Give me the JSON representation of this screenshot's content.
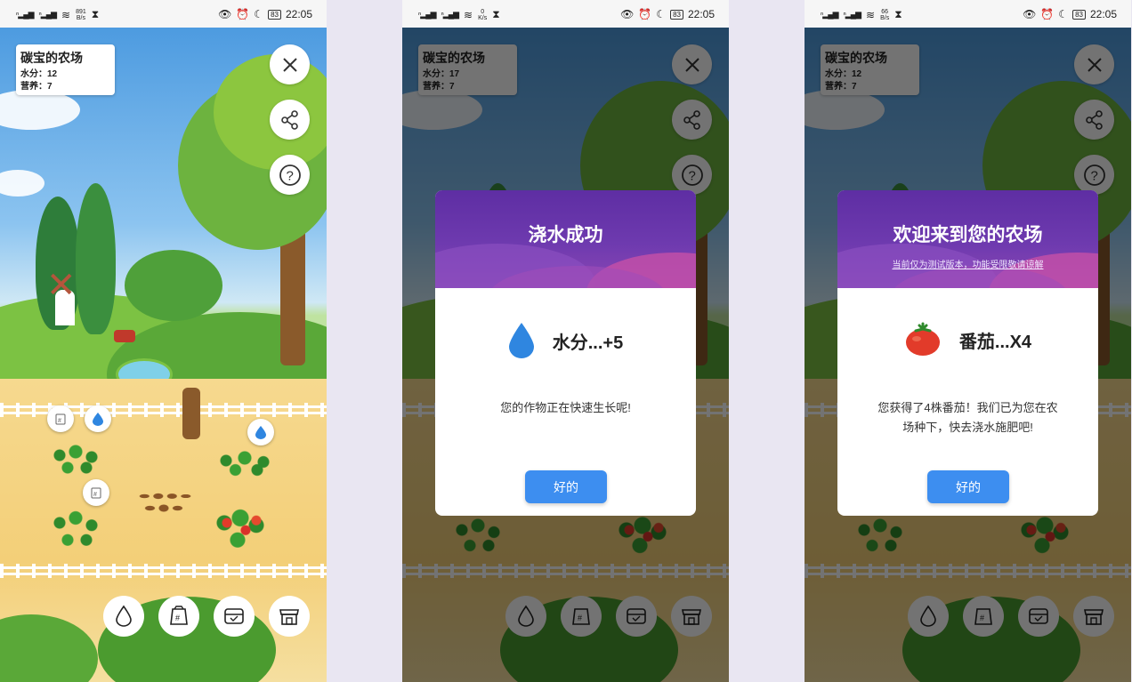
{
  "status": {
    "time": "22:05",
    "speeds": [
      "891\nB/s",
      "0\nK/s",
      "66\nB/s"
    ],
    "battery": "83"
  },
  "farm": {
    "title": "碳宝的农场",
    "water_label": "水分：",
    "nutrition_label": "营养：",
    "screens": [
      {
        "water": "12",
        "nutrition": "7"
      },
      {
        "water": "17",
        "nutrition": "7"
      },
      {
        "water": "12",
        "nutrition": "7"
      }
    ]
  },
  "side_buttons": [
    "close-icon",
    "share-icon",
    "help-icon"
  ],
  "toolbar": [
    "water-drop-icon",
    "seed-bag-icon",
    "inbox-icon",
    "shop-icon"
  ],
  "dialogs": {
    "water": {
      "title": "浇水成功",
      "reward": "水分...+5",
      "message": "您的作物正在快速生长呢!",
      "button": "好的"
    },
    "welcome": {
      "title": "欢迎来到您的农场",
      "subtitle": "当前仅为测试版本，功能受限敬请谅解",
      "reward": "番茄...X4",
      "message": "您获得了4株番茄！我们已为您在农场种下，快去浇水施肥吧!",
      "button": "好的"
    }
  },
  "colors": {
    "accent": "#3d8ef0",
    "dialog_header": "#6e3aaf",
    "water": "#2f86e0",
    "tomato": "#e23b2a"
  }
}
